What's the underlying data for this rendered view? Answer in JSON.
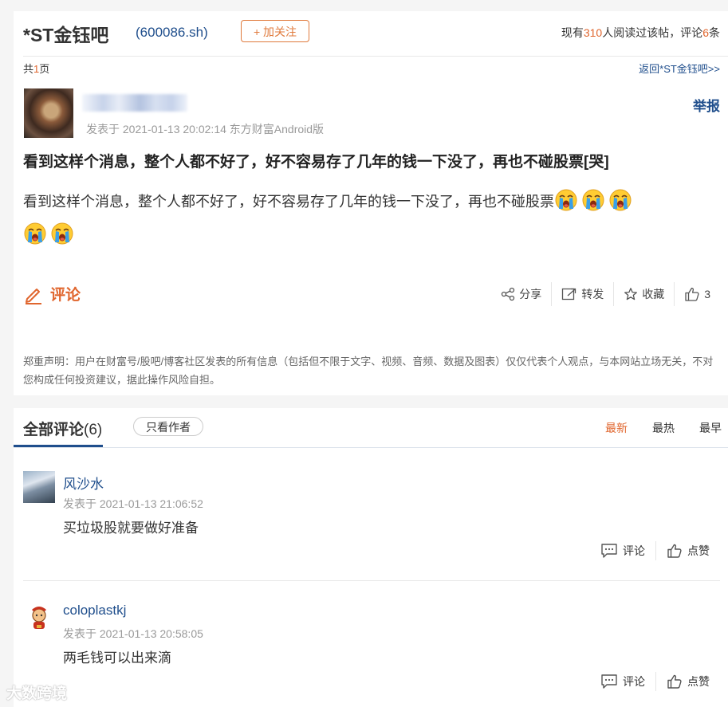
{
  "header": {
    "bar_name": "*ST金钰吧",
    "stock_code": "(600086.sh)",
    "follow_label": "+ 加关注",
    "stats_prefix": "现有",
    "read_count": "310",
    "stats_mid": "人阅读过该帖，评论",
    "comment_count": "6",
    "stats_suffix": "条"
  },
  "pagination": {
    "prefix": "共",
    "pages": "1",
    "suffix": "页",
    "back_link": "返回*ST金钰吧>>"
  },
  "post": {
    "report_label": "举报",
    "meta": "发表于 2021-01-13 20:02:14 东方财富Android版",
    "title": "看到这样个消息，整个人都不好了，好不容易存了几年的钱一下没了，再也不碰股票[哭]",
    "body": "看到这样个消息，整个人都不好了，好不容易存了几年的钱一下没了，再也不碰股票",
    "emoji_count": 5,
    "comment_label": "评论",
    "share_label": "分享",
    "repost_label": "转发",
    "collect_label": "收藏",
    "like_count": "3",
    "disclaimer": "郑重声明：用户在财富号/股吧/博客社区发表的所有信息（包括但不限于文字、视频、音频、数据及图表）仅仅代表个人观点，与本网站立场无关，不对您构成任何投资建议，据此操作风险自担。"
  },
  "comments_section": {
    "tab_label": "全部评论",
    "tab_count": "(6)",
    "only_author": "只看作者",
    "sort_options": [
      "最新",
      "最热",
      "最早"
    ],
    "items": [
      {
        "username": "风沙水",
        "date": "发表于 2021-01-13 21:06:52",
        "text": "买垃圾股就要做好准备",
        "reply_label": "评论",
        "like_label": "点赞"
      },
      {
        "username": "coloplastkj",
        "date": "发表于 2021-01-13 20:58:05",
        "text": "两毛钱可以出来滴",
        "reply_label": "评论",
        "like_label": "点赞"
      }
    ]
  },
  "watermark": "大数跨境",
  "colors": {
    "accent_orange": "#e0662e",
    "link_blue": "#1f4e8c"
  }
}
